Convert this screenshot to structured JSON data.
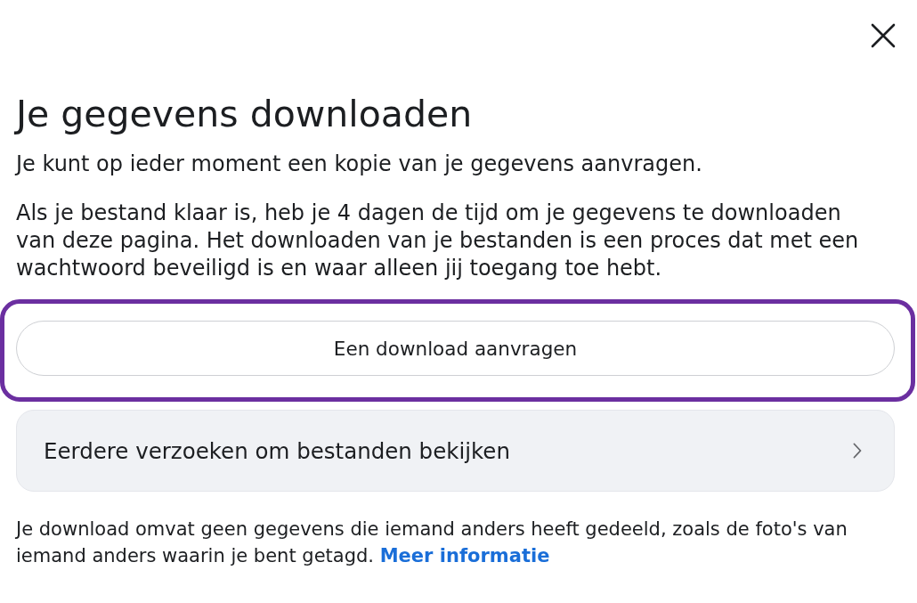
{
  "dialog": {
    "title": "Je gegevens downloaden",
    "intro": "Je kunt op ieder moment een kopie van je gegevens aanvragen.",
    "description": "Als je bestand klaar is, heb je 4 dagen de tijd om je gegevens te downloaden van deze pagina. Het downloaden van je bestanden is een proces dat met een wachtwoord beveiligd is en waar alleen jij toegang toe hebt.",
    "request_button": {
      "label": "Een download aanvragen",
      "highlighted": true
    },
    "history_row": {
      "label": "Eerdere verzoeken om bestanden bekijken"
    },
    "footnote": "Je download omvat geen gegevens die iemand anders heeft gedeeld, zoals de foto's van iemand anders waarin je bent getagd.",
    "footnote_link": "Meer informatie"
  }
}
